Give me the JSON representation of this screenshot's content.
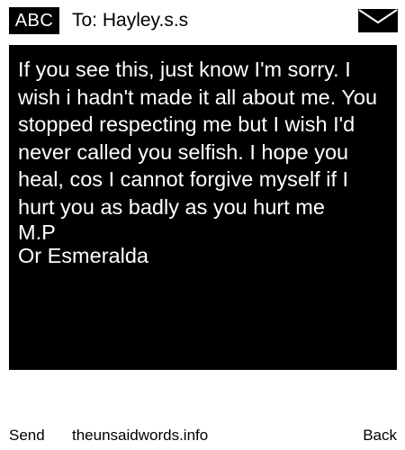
{
  "header": {
    "mode_badge": "ABC",
    "recipient": "To: Hayley.s.s",
    "icon": "envelope-icon"
  },
  "message": {
    "body": "If you see this, just know I'm sorry. I wish i hadn't made it all about me. You stopped respecting me but I wish I'd never called you selfish. I hope you heal, cos I cannot forgive myself if I hurt you as badly as you hurt me",
    "signature_line_1": "M.P",
    "signature_line_2": "Or Esmeralda"
  },
  "softkeys": {
    "left_label": "Send",
    "center_label": "theunsaidwords.info",
    "right_label": "Back"
  },
  "colors": {
    "background": "#ffffff",
    "message_background": "#000000",
    "message_text": "#ffffff"
  }
}
